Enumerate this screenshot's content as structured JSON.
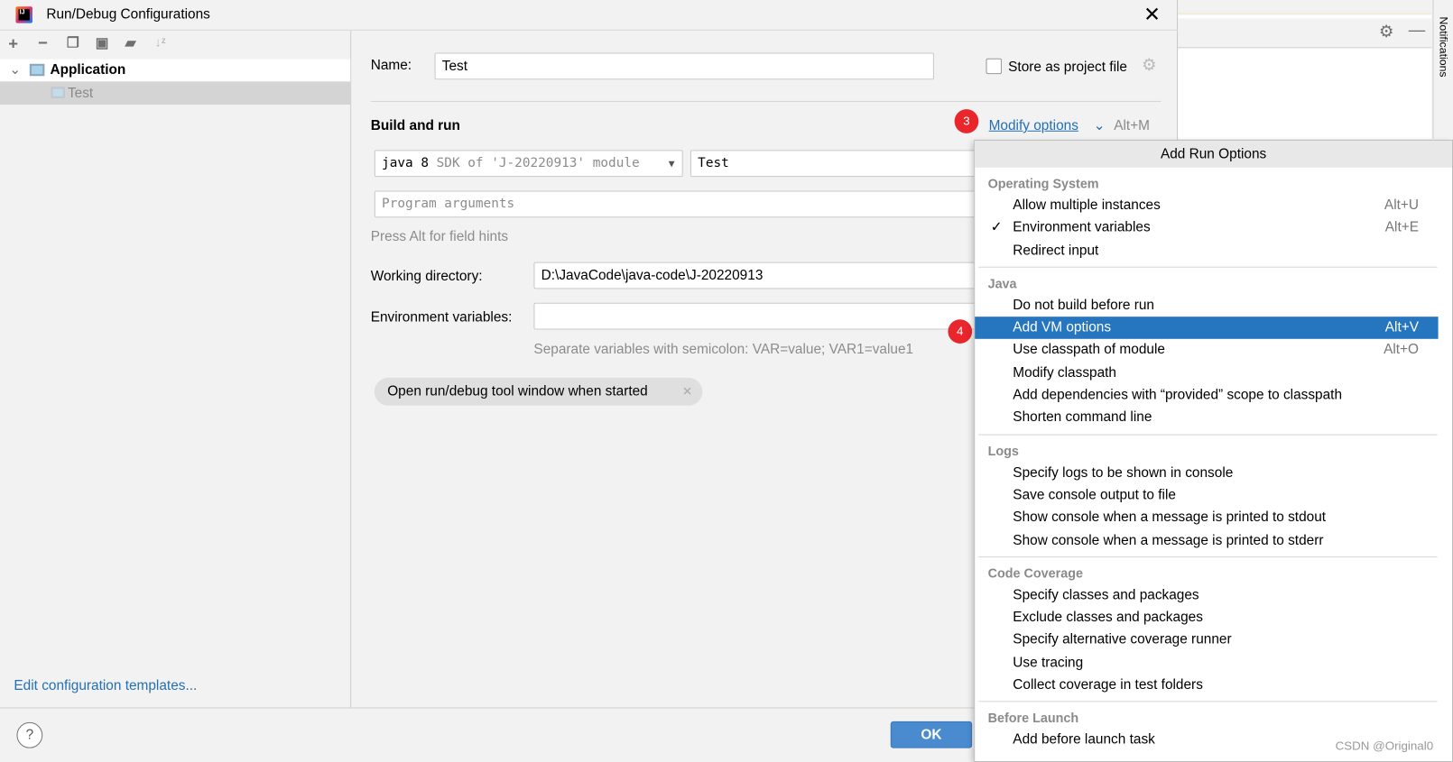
{
  "window": {
    "title": "Run/Debug Configurations",
    "app_icon": "intellij-icon"
  },
  "toolbar": {
    "icons": [
      "plus-icon",
      "minus-icon",
      "copy-icon",
      "save-icon",
      "folder-add-icon",
      "sort-icon"
    ]
  },
  "tree": {
    "group": "Application",
    "items": [
      {
        "label": "Test",
        "selected": true
      }
    ]
  },
  "sidebar": {
    "edit_templates": "Edit configuration templates..."
  },
  "form": {
    "name_label": "Name:",
    "name_value": "Test",
    "store_label": "Store as project file",
    "section": "Build and run",
    "modify_options": "Modify options",
    "modify_shortcut": "Alt+M",
    "jdk_main": "java 8",
    "jdk_sub": "SDK of 'J-20220913' module",
    "main_class": "Test",
    "program_args_placeholder": "Program arguments",
    "field_hint": "Press Alt for field hints",
    "workdir_label": "Working directory:",
    "workdir_value": "D:\\JavaCode\\java-code\\J-20220913",
    "env_label": "Environment variables:",
    "env_value": "",
    "env_hint": "Separate variables with semicolon: VAR=value; VAR1=value1",
    "chip": "Open run/debug tool window when started"
  },
  "badges": {
    "b3": "3",
    "b4": "4"
  },
  "footer": {
    "ok": "OK",
    "help": "?"
  },
  "side_panel": {
    "notifications": "Notifications"
  },
  "menu": {
    "title": "Add Run Options",
    "sections": [
      {
        "name": "Operating System",
        "items": [
          {
            "label": "Allow multiple instances",
            "shortcut": "Alt+U"
          },
          {
            "label": "Environment variables",
            "shortcut": "Alt+E",
            "checked": true
          },
          {
            "label": "Redirect input",
            "shortcut": ""
          }
        ]
      },
      {
        "name": "Java",
        "items": [
          {
            "label": "Do not build before run",
            "shortcut": ""
          },
          {
            "label": "Add VM options",
            "shortcut": "Alt+V",
            "selected": true
          },
          {
            "label": "Use classpath of module",
            "shortcut": "Alt+O"
          },
          {
            "label": "Modify classpath",
            "shortcut": ""
          },
          {
            "label": "Add dependencies with “provided” scope to classpath",
            "shortcut": ""
          },
          {
            "label": "Shorten command line",
            "shortcut": ""
          }
        ]
      },
      {
        "name": "Logs",
        "items": [
          {
            "label": "Specify logs to be shown in console",
            "shortcut": ""
          },
          {
            "label": "Save console output to file",
            "shortcut": ""
          },
          {
            "label": "Show console when a message is printed to stdout",
            "shortcut": ""
          },
          {
            "label": "Show console when a message is printed to stderr",
            "shortcut": ""
          }
        ]
      },
      {
        "name": "Code Coverage",
        "items": [
          {
            "label": "Specify classes and packages",
            "shortcut": ""
          },
          {
            "label": "Exclude classes and packages",
            "shortcut": ""
          },
          {
            "label": "Specify alternative coverage runner",
            "shortcut": ""
          },
          {
            "label": "Use tracing",
            "shortcut": ""
          },
          {
            "label": "Collect coverage in test folders",
            "shortcut": ""
          }
        ]
      },
      {
        "name": "Before Launch",
        "items": [
          {
            "label": "Add before launch task",
            "shortcut": ""
          }
        ]
      }
    ]
  },
  "watermark": "CSDN @Original0",
  "colors": {
    "accent": "#2675bf",
    "link": "#2470b3",
    "badge": "#e8262c",
    "ok_button": "#4a8bd0"
  }
}
